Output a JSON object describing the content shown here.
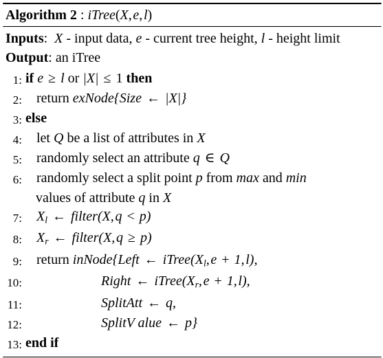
{
  "algorithm": {
    "title_label": "Algorithm 2",
    "title_separator": ":",
    "title_signature": "iTree(X, e, l)",
    "inputs_label": "Inputs",
    "inputs_text": "X - input data, e - current tree height, l - height limit",
    "output_label": "Output",
    "output_text": "an iTree"
  },
  "steps": [
    {
      "num": "1:",
      "indent": 0,
      "text": "if e ≥ l or |X| ≤ 1 then",
      "keywords": [
        "if",
        "then"
      ]
    },
    {
      "num": "2:",
      "indent": 1,
      "text": "return exNode{Size ← |X|}",
      "keywords": []
    },
    {
      "num": "3:",
      "indent": 0,
      "text": "else",
      "keywords": [
        "else"
      ]
    },
    {
      "num": "4:",
      "indent": 1,
      "text": "let Q be a list of attributes in X",
      "keywords": []
    },
    {
      "num": "5:",
      "indent": 1,
      "text": "randomly select an attribute q ∈ Q",
      "keywords": []
    },
    {
      "num": "6:",
      "indent": 1,
      "text": "randomly select a split point p from max and min",
      "continuation": "values of attribute q in X",
      "keywords": []
    },
    {
      "num": "7:",
      "indent": 1,
      "text": "Xₗ ← filter(X, q < p)",
      "keywords": []
    },
    {
      "num": "8:",
      "indent": 1,
      "text": "Xᵣ ← filter(X, q ≥ p)",
      "keywords": []
    },
    {
      "num": "9:",
      "indent": 1,
      "text": "return inNode{Left ← iTree(Xₗ, e + 1, l),",
      "keywords": []
    },
    {
      "num": "10:",
      "indent": 5,
      "text": "Right ← iTree(Xᵣ, e + 1, l),",
      "keywords": []
    },
    {
      "num": "11:",
      "indent": 5,
      "text": "SplitAtt ← q,",
      "keywords": []
    },
    {
      "num": "12:",
      "indent": 5,
      "text": "SplitValue ← p}",
      "keywords": []
    },
    {
      "num": "13:",
      "indent": 0,
      "text": "end if",
      "keywords": [
        "end if"
      ]
    }
  ]
}
